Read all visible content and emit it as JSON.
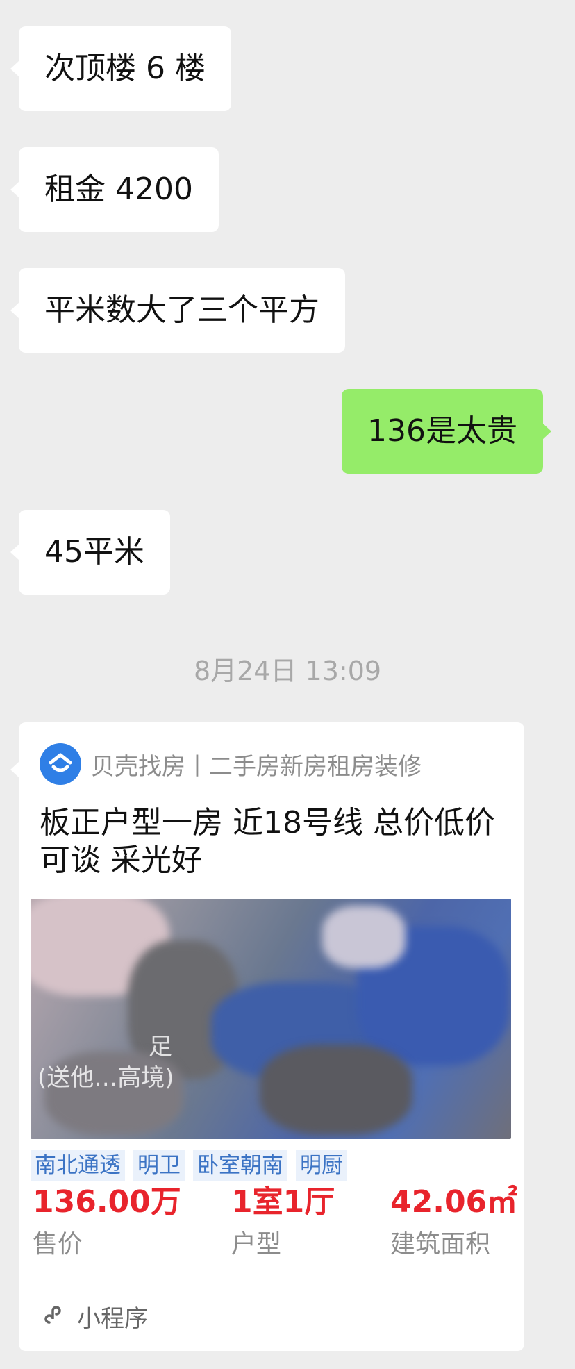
{
  "chat": {
    "messages": [
      {
        "text": "次顶楼 6 楼",
        "side": "received"
      },
      {
        "text": "租金 4200",
        "side": "received"
      },
      {
        "text": "平米数大了三个平方",
        "side": "received"
      },
      {
        "text": "136是太贵",
        "side": "sent"
      },
      {
        "text": "45平米",
        "side": "received"
      }
    ],
    "timestamp": "8月24日 13:09"
  },
  "card": {
    "source_name": "贝壳找房丨二手房新房租房装修",
    "source_icon": "beike-logo-icon",
    "title": "板正户型一房 近18号线 总价低价可谈 采光好",
    "photo_overlay_text": "足",
    "photo_overlay_text2": "(送他…高境)",
    "tags": [
      "南北通透",
      "明卫",
      "卧室朝南",
      "明厨"
    ],
    "stats": [
      {
        "value": "136.00万",
        "label": "售价"
      },
      {
        "value": "1室1厅",
        "label": "户型"
      },
      {
        "value": "42.06㎡",
        "label": "建筑面积"
      }
    ],
    "footer": {
      "icon": "mini-program-icon",
      "label": "小程序"
    }
  },
  "colors": {
    "background": "#ededed",
    "bubble_received": "#ffffff",
    "bubble_sent": "#95ec69",
    "accent_red": "#e8242c",
    "tag_blue": "#3b73c4",
    "brand_blue": "#2f7fe6"
  }
}
